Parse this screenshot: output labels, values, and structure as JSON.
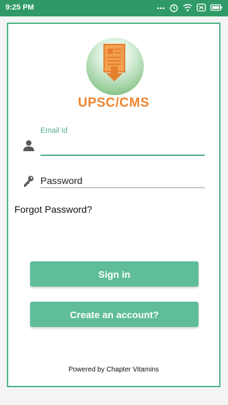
{
  "status_bar": {
    "time": "9:25 PM",
    "icons": [
      "more-icon",
      "alarm-icon",
      "wifi-icon",
      "sim-icon",
      "battery-icon"
    ]
  },
  "app": {
    "title": "UPSC/CMS",
    "brand_color": "#ef8531",
    "accent_color": "#4fae86"
  },
  "login": {
    "email_label": "Email Id",
    "email_value": "",
    "password_placeholder": "Password",
    "forgot_label": "Forgot Password?",
    "signin_label": "Sign in",
    "create_label": "Create an account?"
  },
  "footer": {
    "powered_by": "Powered by Chapter Vitamins"
  }
}
